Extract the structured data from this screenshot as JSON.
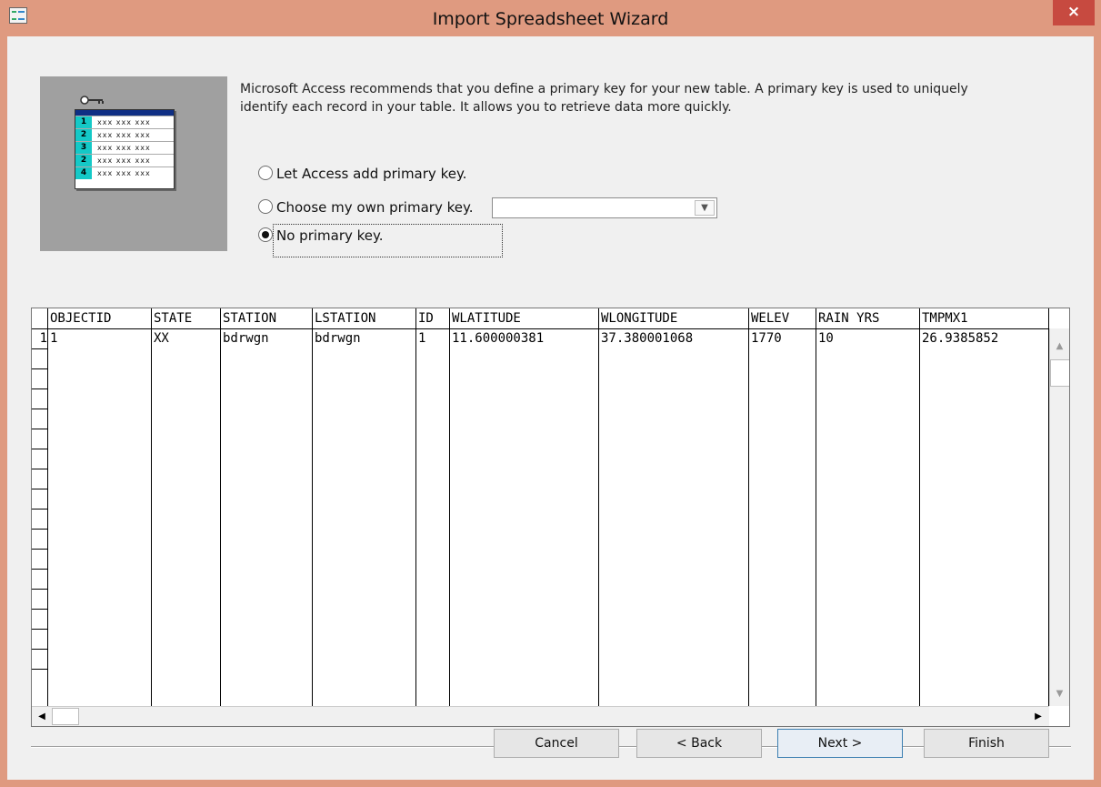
{
  "window": {
    "title": "Import Spreadsheet Wizard",
    "close_label": "×"
  },
  "intro": {
    "text": "Microsoft Access recommends that you define a primary key for your new table. A primary key is used to uniquely identify each record in your table. It allows you to retrieve data more quickly."
  },
  "illustration": {
    "rows": [
      {
        "num": "1",
        "dots": "xxx xxx xxx"
      },
      {
        "num": "2",
        "dots": "xxx xxx xxx"
      },
      {
        "num": "3",
        "dots": "xxx xxx xxx"
      },
      {
        "num": "2",
        "dots": "xxx xxx xxx"
      },
      {
        "num": "4",
        "dots": "xxx xxx xxx"
      }
    ]
  },
  "options": [
    {
      "label": "Let Access add primary key.",
      "selected": false
    },
    {
      "label": "Choose my own primary key.",
      "selected": false
    },
    {
      "label": "No primary key.",
      "selected": true
    }
  ],
  "key_combo": {
    "value": ""
  },
  "grid": {
    "columns": [
      "OBJECTID",
      "STATE",
      "STATION",
      "LSTATION",
      "ID",
      "WLATITUDE",
      "WLONGITUDE",
      "WELEV",
      "RAIN YRS",
      "TMPMX1"
    ],
    "rows": [
      {
        "num": "1",
        "cells": [
          "1",
          "XX",
          "bdrwgn",
          "bdrwgn",
          "1",
          "11.600000381",
          "37.380001068",
          "1770",
          "10",
          "26.9385852"
        ]
      }
    ]
  },
  "buttons": {
    "cancel": "Cancel",
    "back": "< Back",
    "next": "Next >",
    "finish": "Finish"
  }
}
